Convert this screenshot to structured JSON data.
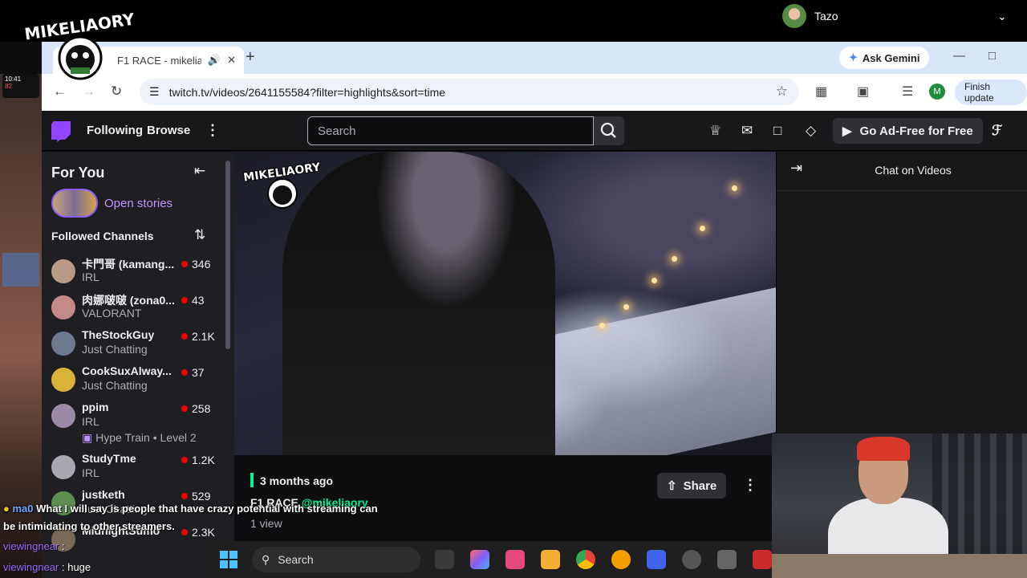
{
  "profile": {
    "name": "Tazo"
  },
  "browser": {
    "tab_title": "F1 RACE - mikeliaory - Twitch",
    "new_tab": "+",
    "gemini_label": "Ask Gemini",
    "url": "twitch.tv/videos/2641155584?filter=highlights&sort=time",
    "avatar_letter": "M",
    "finish_update": "Finish update",
    "logo_text": "MIKELIAORY"
  },
  "twitch": {
    "nav": {
      "following": "Following",
      "browse": "Browse",
      "search_placeholder": "Search",
      "go_adfree": "Go Ad-Free for Free"
    },
    "sidebar": {
      "title": "For You",
      "open_stories": "Open stories",
      "followed_title": "Followed Channels",
      "channels": [
        {
          "name": "卡門哥 (kamang...",
          "category": "IRL",
          "viewers": "346"
        },
        {
          "name": "肉娜啵啵 (zona0...",
          "category": "VALORANT",
          "viewers": "43"
        },
        {
          "name": "TheStockGuy",
          "category": "Just Chatting",
          "viewers": "2.1K"
        },
        {
          "name": "CookSuxAlway...",
          "category": "Just Chatting",
          "viewers": "37"
        },
        {
          "name": "ppim",
          "category": "IRL",
          "viewers": "258",
          "extra": "Hype Train • Level 2"
        },
        {
          "name": "StudyTme",
          "category": "IRL",
          "viewers": "1.2K"
        },
        {
          "name": "justketh",
          "category": "Just Chatting",
          "viewers": "529"
        },
        {
          "name": "MidnightSumo",
          "category": "",
          "viewers": "2.3K"
        }
      ]
    },
    "video": {
      "age": "3 months ago",
      "title_prefix": "F1 RACE ",
      "title_mention": "@mikeliaory",
      "views": "1 view",
      "share": "Share"
    },
    "chat": {
      "title": "Chat on Videos"
    }
  },
  "overlay": {
    "phone_time": "10:41",
    "phone_hr": "82",
    "subtitle_user": "ma0",
    "subtitle_line1": "What I will say is people that have crazy potential with streaming can",
    "subtitle_line2": "be intimidating to other streamers.",
    "chat1_user": "viewingnear",
    "chat1_sep": " :",
    "chat2_user": "viewingnear",
    "chat2_msg": " : huge"
  },
  "taskbar": {
    "search": "Search"
  },
  "colors": {
    "twitch_purple": "#9146ff",
    "live_red": "#eb0400",
    "accent_green": "#00f593"
  }
}
